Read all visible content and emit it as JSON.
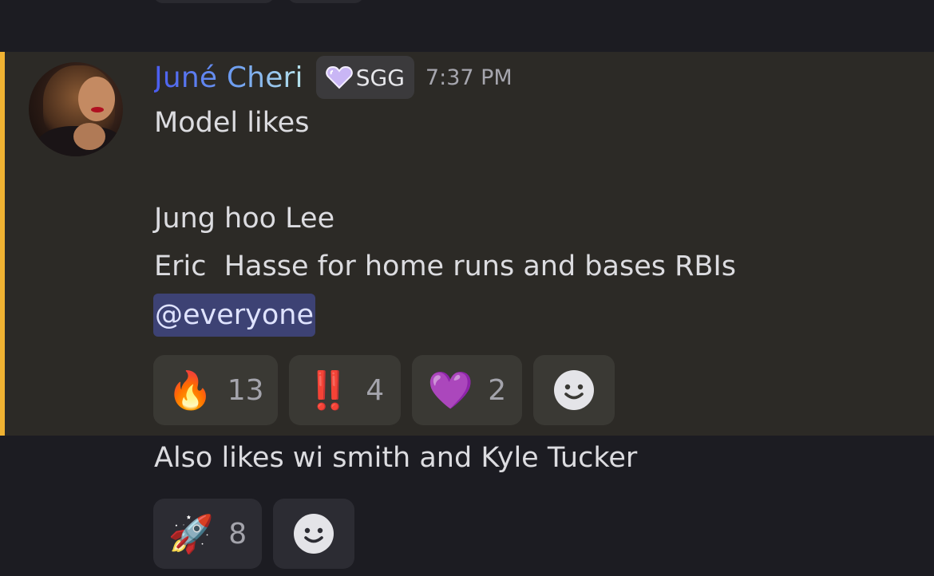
{
  "message": {
    "author": "Juné Cheri",
    "guild_tag": "SGG",
    "timestamp": "7:37 PM",
    "lines": [
      "Model likes",
      "Jung hoo Lee",
      "Eric  Hasse for home runs and bases RBIs"
    ],
    "mention": "@everyone",
    "reactions": [
      {
        "emoji": "🔥",
        "count": "13",
        "icon": "fire-emoji"
      },
      {
        "emoji": "‼️",
        "count": "4",
        "icon": "double-exclamation-emoji"
      },
      {
        "emoji": "💜",
        "count": "2",
        "icon": "purple-heart-emoji"
      }
    ],
    "add_reaction_icon": "smile-icon",
    "highlight_color": "#f0b232",
    "mention_bg": "#3d4274"
  },
  "followup": {
    "text": "Also likes wi smith and Kyle Tucker",
    "reactions": [
      {
        "emoji": "🚀",
        "count": "8",
        "icon": "rocket-emoji"
      }
    ]
  }
}
